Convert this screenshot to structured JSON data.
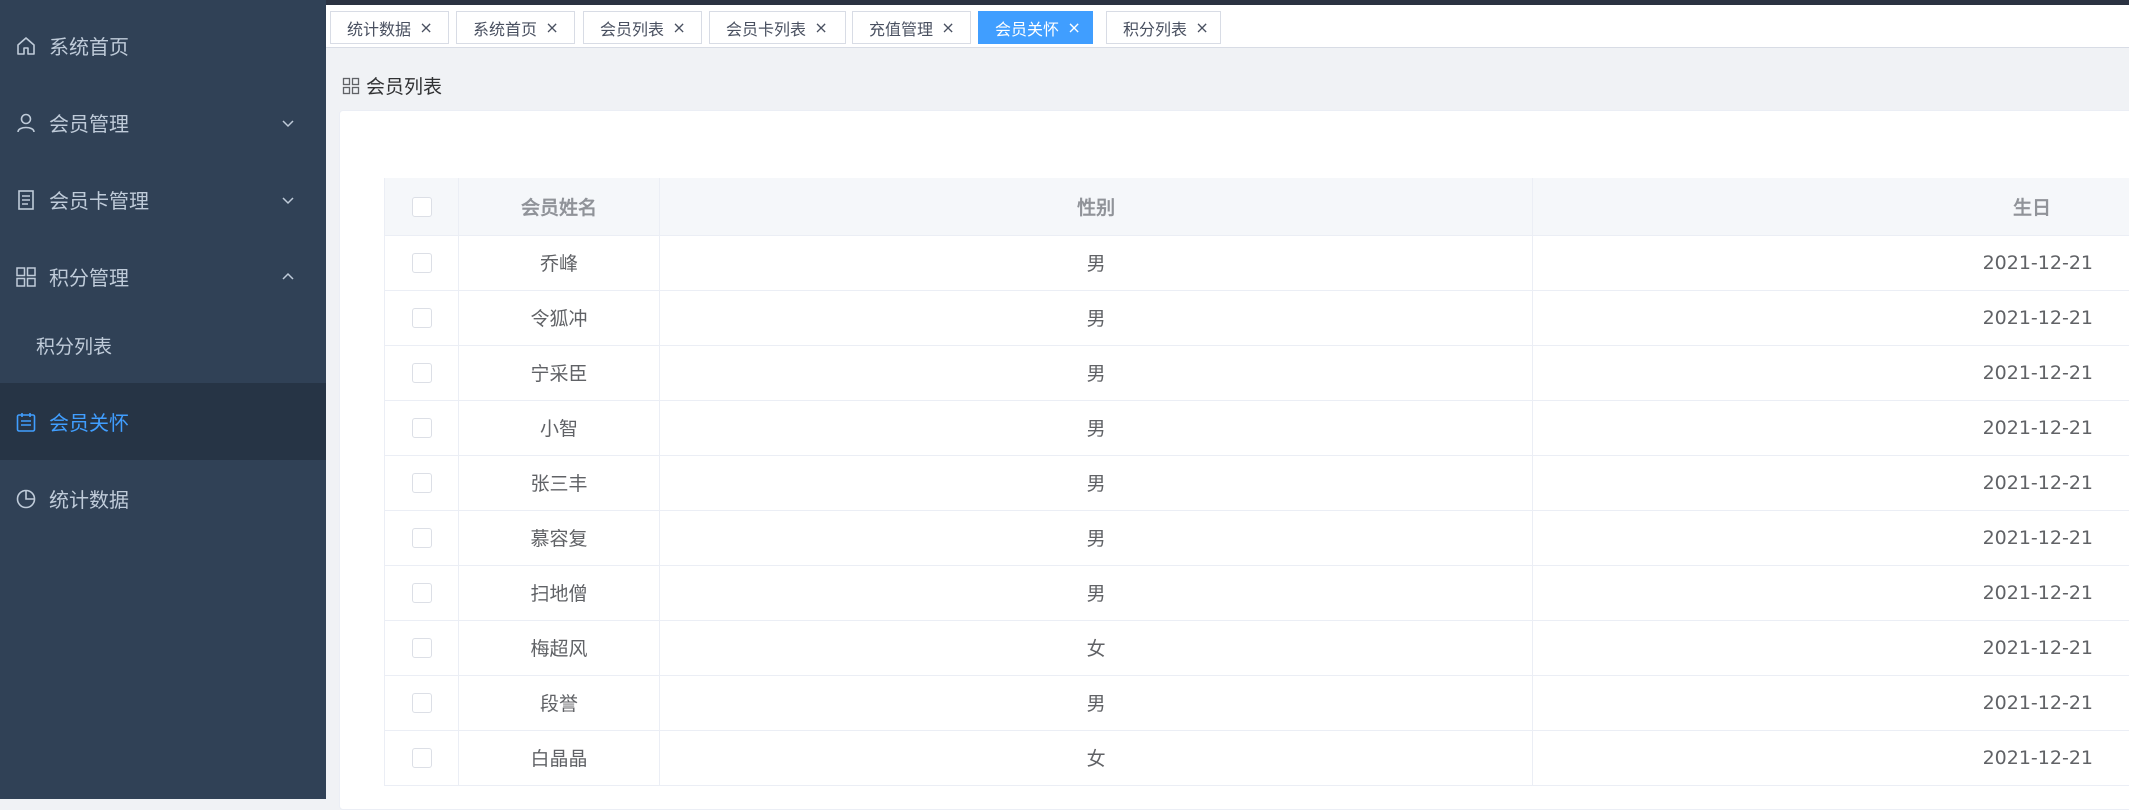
{
  "colors": {
    "sidebar_bg": "#304156",
    "active": "#409eff",
    "sidebar_text": "#bfcbd9"
  },
  "sidebar": {
    "items": [
      {
        "label": "系统首页",
        "icon": "home-icon",
        "chevron": ""
      },
      {
        "label": "会员管理",
        "icon": "user-icon",
        "chevron": "down"
      },
      {
        "label": "会员卡管理",
        "icon": "document-icon",
        "chevron": "down"
      },
      {
        "label": "积分管理",
        "icon": "grid-icon",
        "chevron": "up"
      },
      {
        "label": "会员关怀",
        "icon": "calendar-icon",
        "chevron": "",
        "active": true
      },
      {
        "label": "统计数据",
        "icon": "pie-chart-icon",
        "chevron": ""
      }
    ],
    "subitems": [
      {
        "label": "积分列表"
      }
    ]
  },
  "tags": [
    {
      "label": "统计数据",
      "active": false
    },
    {
      "label": "系统首页",
      "active": false
    },
    {
      "label": "会员列表",
      "active": false
    },
    {
      "label": "会员卡列表",
      "active": false
    },
    {
      "label": "充值管理",
      "active": false
    },
    {
      "label": "会员关怀",
      "active": true
    },
    {
      "label": "积分列表",
      "active": false
    }
  ],
  "breadcrumb": {
    "label": "会员列表",
    "icon": "grid-icon"
  },
  "table": {
    "headers": {
      "name": "会员姓名",
      "gender": "性别",
      "birthday": "生日"
    },
    "rows": [
      {
        "name": "乔峰",
        "gender": "男",
        "birthday": "2021-12-21"
      },
      {
        "name": "令狐冲",
        "gender": "男",
        "birthday": "2021-12-21"
      },
      {
        "name": "宁采臣",
        "gender": "男",
        "birthday": "2021-12-21"
      },
      {
        "name": "小智",
        "gender": "男",
        "birthday": "2021-12-21"
      },
      {
        "name": "张三丰",
        "gender": "男",
        "birthday": "2021-12-21"
      },
      {
        "name": "慕容复",
        "gender": "男",
        "birthday": "2021-12-21"
      },
      {
        "name": "扫地僧",
        "gender": "男",
        "birthday": "2021-12-21"
      },
      {
        "name": "梅超风",
        "gender": "女",
        "birthday": "2021-12-21"
      },
      {
        "name": "段誉",
        "gender": "男",
        "birthday": "2021-12-21"
      },
      {
        "name": "白晶晶",
        "gender": "女",
        "birthday": "2021-12-21"
      }
    ]
  }
}
